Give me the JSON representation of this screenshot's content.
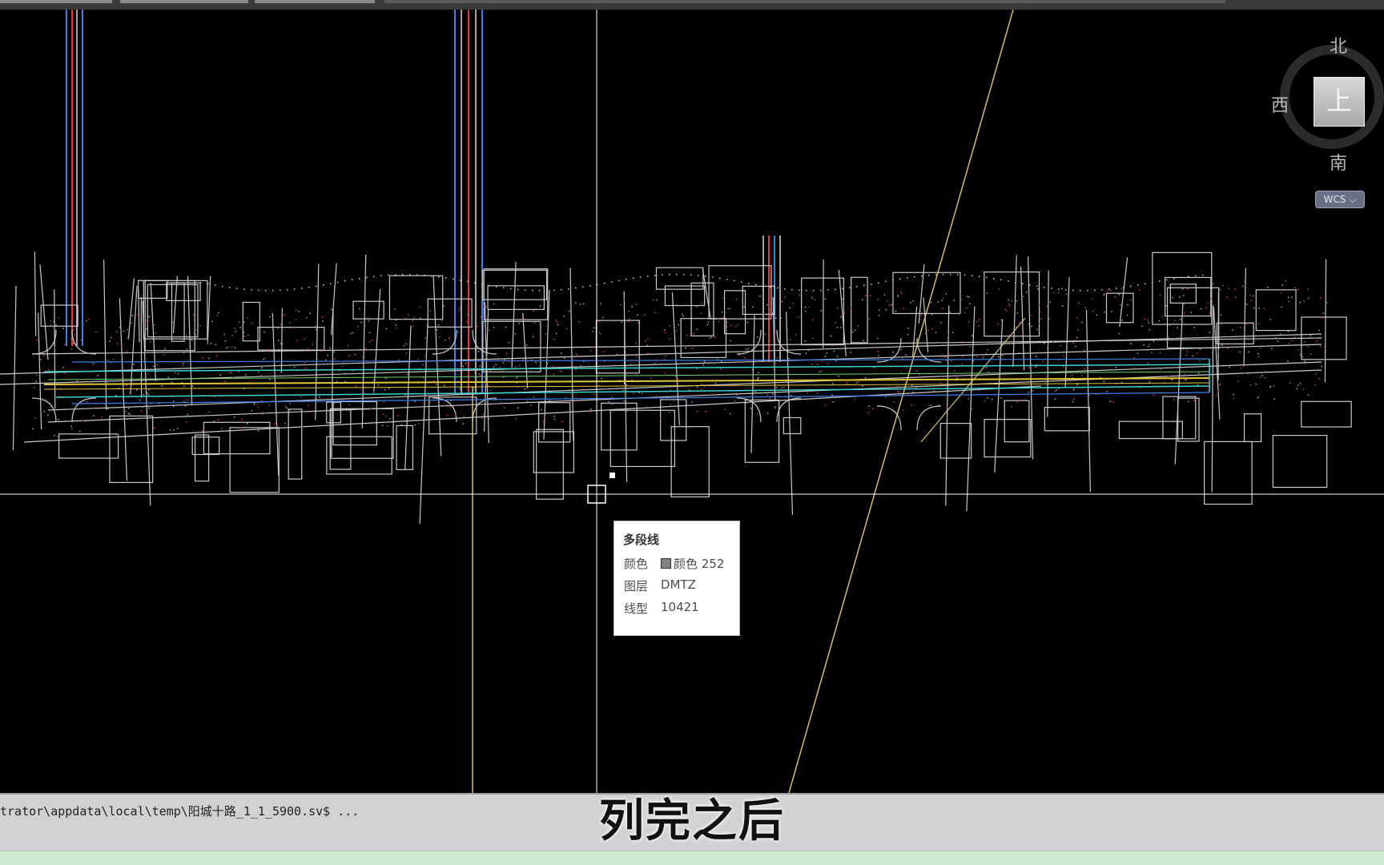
{
  "viewcube": {
    "north": "北",
    "west": "西",
    "south": "南",
    "face": "上",
    "wcs": "WCS ⌵"
  },
  "tooltip": {
    "title": "多段线",
    "rows": [
      {
        "key": "颜色",
        "value": "颜色 252"
      },
      {
        "key": "图层",
        "value": "DMTZ"
      },
      {
        "key": "线型",
        "value": "10421"
      }
    ]
  },
  "command": {
    "text": "trator\\appdata\\local\\temp\\阳城十路_1_1_5900.sv$ ..."
  },
  "subtitle": "列完之后",
  "colors": {
    "background": "#000000",
    "road_lines": "#c9c9c9",
    "survey_points": "#b04545",
    "centerline": "#e2c63a",
    "pipe_blue": "#3f7fe6",
    "pipe_red": "#e03a3a",
    "pipe_cyan": "#3ed2d2",
    "crosshair": "#ffffff"
  }
}
